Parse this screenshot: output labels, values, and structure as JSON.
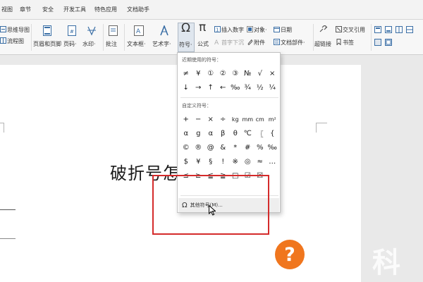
{
  "ribbon_tabs": [
    "视图",
    "章节",
    "安全",
    "开发工具",
    "特色应用",
    "文档助手"
  ],
  "ribbon": {
    "mindmap": "思维导图",
    "flowchart": "流程图",
    "header_footer": "页眉和页脚",
    "page_number": "页码·",
    "watermark": "水印·",
    "comment": "批注",
    "textbox": "文本框·",
    "wordart": "艺术字·",
    "symbol": "符号·",
    "formula": "公式",
    "insert_number": "插入数字",
    "object": "对象·",
    "date": "日期",
    "first_drop": "首字下沉",
    "attachment": "附件",
    "doc_parts": "文档部件·",
    "cross_ref": "交叉引用",
    "hyperlink": "超链接",
    "bookmark": "书签"
  },
  "dropdown": {
    "recent_title": "近期使用的符号：",
    "recent_symbols": [
      "≠",
      "¥",
      "①",
      "②",
      "③",
      "№",
      "√",
      "×",
      "↓",
      "→",
      "↑",
      "←",
      "‰",
      "¾",
      "½",
      "¼"
    ],
    "custom_title": "自定义符号：",
    "custom_symbols": [
      "+",
      "−",
      "×",
      "÷",
      "kg",
      "mm",
      "cm",
      "m²",
      "α",
      "g",
      "α",
      "β",
      "θ",
      "℃",
      "〖",
      "{",
      "©",
      "®",
      "@",
      "&",
      "*",
      "#",
      "%",
      "‰",
      "$",
      "¥",
      "§",
      "!",
      "※",
      "◎",
      "≈",
      "…",
      "≤",
      "≥",
      "≦",
      "≧",
      "□",
      "☑",
      "☒"
    ],
    "more_label": "其他符号(M)..."
  },
  "document": {
    "text": "破折号怎"
  },
  "watermark": {
    "badge": "?",
    "text": "科"
  },
  "colors": {
    "highlight": "#d42b2b",
    "badge": "#f0761e",
    "selected_button": "#dfe6ee"
  }
}
